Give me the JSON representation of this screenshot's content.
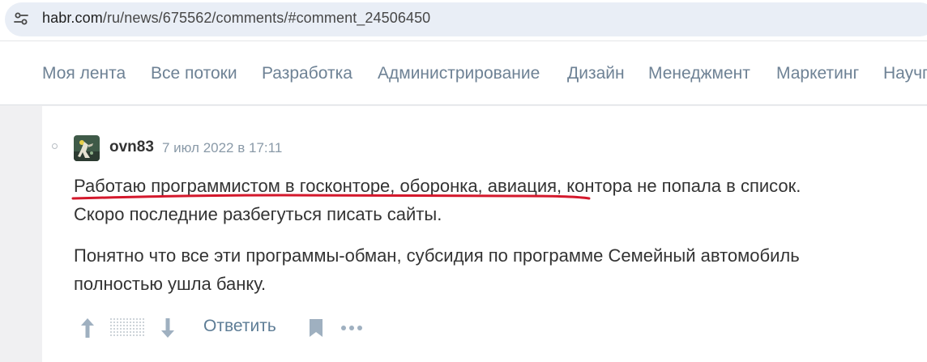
{
  "browser": {
    "url_host": "habr.com",
    "url_path": "/ru/news/675562/comments/#comment_24506450",
    "site_info_icon": "tune-icon"
  },
  "nav": {
    "items": [
      {
        "label": "Моя лента"
      },
      {
        "label": "Все потоки"
      },
      {
        "label": "Разработка"
      },
      {
        "label": "Администрирование"
      },
      {
        "label": "Дизайн"
      },
      {
        "label": "Менеджмент"
      },
      {
        "label": "Маркетинг"
      },
      {
        "label": "Научпоп"
      }
    ]
  },
  "comment": {
    "username": "ovn83",
    "timestamp": "7 июл 2022 в 17:11",
    "paragraph1": {
      "underlined": "Работаю программистом в госконторе, оборонка, авиация,",
      "rest": " контора не попала в список.",
      "line2": "Скоро последние разбегуться писать сайты."
    },
    "paragraph2": {
      "line1": "Понятно что все эти программы-обман, субсидия по программе Семейный автомобиль",
      "line2": "полностью ушла банку."
    },
    "annotation_color": "#d4182c"
  },
  "actions": {
    "reply_label": "Ответить",
    "vote_up_icon": "arrow-up-icon",
    "vote_down_icon": "arrow-down-icon",
    "bookmark_icon": "bookmark-icon",
    "more_icon": "more-dots-icon"
  },
  "colors": {
    "nav_text": "#6e8295",
    "body_text": "#333333",
    "meta_text": "#8a9aa8",
    "action_icon": "#9fb0c0",
    "reply_text": "#5e7d96"
  }
}
